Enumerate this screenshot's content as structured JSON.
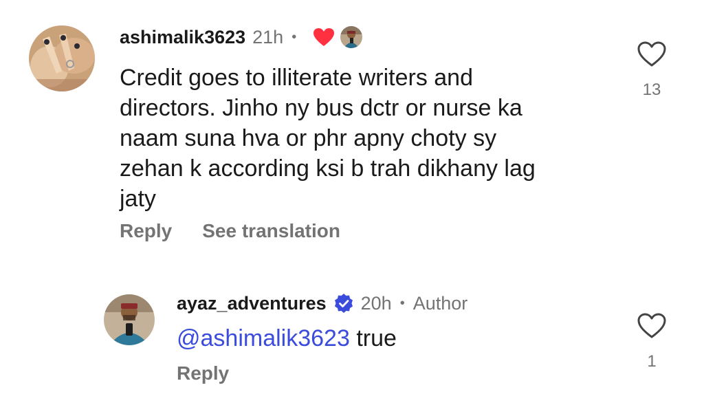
{
  "comments": [
    {
      "username": "ashimalik3623",
      "time": "21h",
      "separator": "•",
      "liked_by_author_icon": "heart-filled-icon",
      "text_lines": [
        "Credit goes to illiterate writers and",
        "directors. Jinho ny bus dctr or nurse ka",
        "naam suna hva or phr apny choty sy",
        "zehan k according ksi b trah dikhany lag",
        "jaty"
      ],
      "reply_label": "Reply",
      "translate_label": "See translation",
      "like_count": "13",
      "like_icon": "heart-outline-icon"
    },
    {
      "username": "ayaz_adventures",
      "verified_icon": "verified-badge-icon",
      "time": "20h",
      "separator": "•",
      "author_label": "Author",
      "mention": "@ashimalik3623",
      "text": " true",
      "reply_label": "Reply",
      "like_count": "1",
      "like_icon": "heart-outline-icon"
    }
  ],
  "colors": {
    "heart_red": "#ff3040",
    "verified_blue": "#3b4bdb",
    "mention_blue": "#3b4bdb",
    "secondary_text": "#737373"
  }
}
